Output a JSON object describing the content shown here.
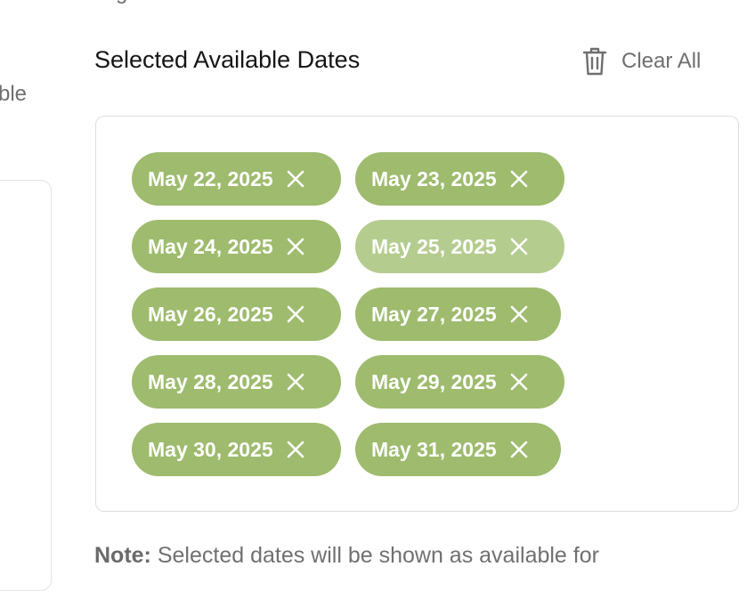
{
  "left_panel": {
    "cut_text": "ble",
    "top_cut_text": "g"
  },
  "section": {
    "title": "Selected Available Dates",
    "clear_all_label": "Clear All",
    "clear_icon": "trash-icon"
  },
  "colors": {
    "chip": "#9ebb6e",
    "chip_hover": "#b5cc8f",
    "muted_text": "#6f6f6f"
  },
  "chips": [
    {
      "label": "May 22, 2025",
      "remove_icon": "close-icon"
    },
    {
      "label": "May 23, 2025",
      "remove_icon": "close-icon"
    },
    {
      "label": "May 24, 2025",
      "remove_icon": "close-icon"
    },
    {
      "label": "May 25, 2025",
      "remove_icon": "close-icon",
      "hovered": true
    },
    {
      "label": "May 26, 2025",
      "remove_icon": "close-icon"
    },
    {
      "label": "May 27, 2025",
      "remove_icon": "close-icon"
    },
    {
      "label": "May 28, 2025",
      "remove_icon": "close-icon"
    },
    {
      "label": "May 29, 2025",
      "remove_icon": "close-icon"
    },
    {
      "label": "May 30, 2025",
      "remove_icon": "close-icon"
    },
    {
      "label": "May 31, 2025",
      "remove_icon": "close-icon"
    }
  ],
  "note": {
    "label": "Note:",
    "text": " Selected dates will be shown as available for"
  }
}
